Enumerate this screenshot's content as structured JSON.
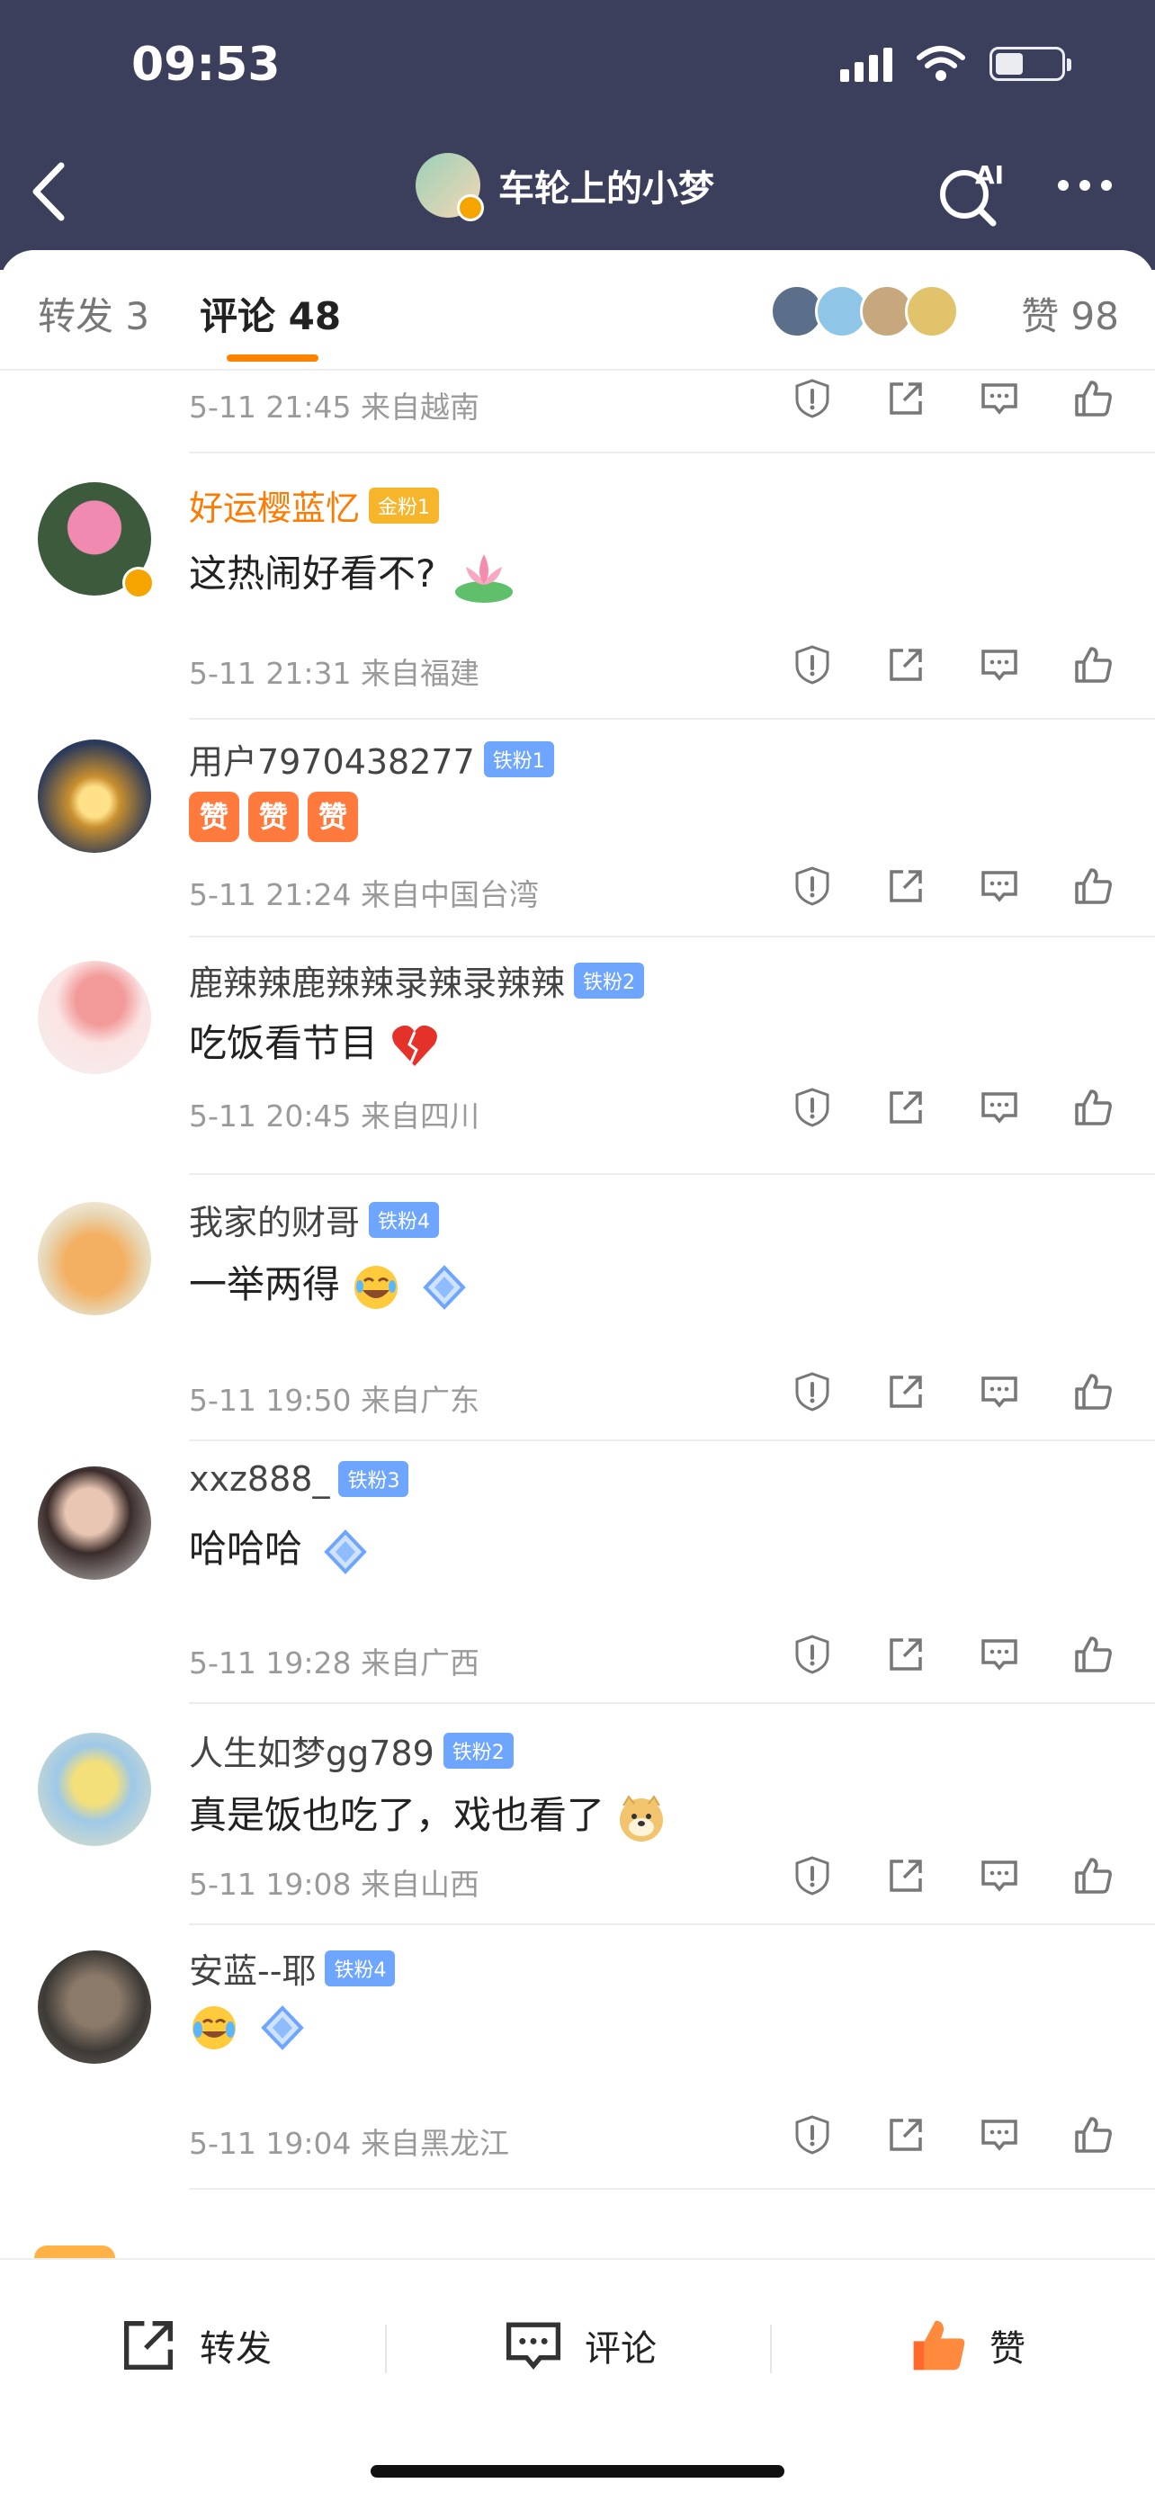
{
  "status_bar": {
    "time": "09:53"
  },
  "nav": {
    "title": "车轮上的小梦",
    "ai_label": "AI"
  },
  "tabs": {
    "repost": "转发 3",
    "comments": "评论 48",
    "likes": "赞 98"
  },
  "comments": [
    {
      "name": "",
      "badge": "",
      "text": "",
      "meta": "5-11 21:45  来自越南"
    },
    {
      "name": "好运樱蓝忆",
      "badge": "金粉1",
      "text": "这热闹好看不?",
      "meta": "5-11 21:31  来自福建"
    },
    {
      "name": "用户7970438277",
      "badge": "铁粉1",
      "text": "",
      "meta": "5-11 21:24  来自中国台湾"
    },
    {
      "name": "鹿辣辣鹿辣辣录辣录辣辣",
      "badge": "铁粉2",
      "text": "吃饭看节目",
      "meta": "5-11 20:45  来自四川"
    },
    {
      "name": "我家的财哥",
      "badge": "铁粉4",
      "text": "一举两得",
      "meta": "5-11 19:50  来自广东"
    },
    {
      "name": "xxz888_",
      "badge": "铁粉3",
      "text": "哈哈哈",
      "meta": "5-11 19:28  来自广西"
    },
    {
      "name": "人生如梦gg789",
      "badge": "铁粉2",
      "text": "真是饭也吃了，戏也看了",
      "meta": "5-11 19:08  来自山西"
    },
    {
      "name": "安蓝--耶",
      "badge": "铁粉4",
      "text": "",
      "meta": "5-11 19:04  来自黑龙江"
    }
  ],
  "stickers": {
    "zan": "赞"
  },
  "bottom_bar": {
    "repost": "转发",
    "comment": "评论",
    "like": "赞"
  },
  "colors": {
    "header": "#3b3f5c",
    "accent": "#ff8200",
    "badge": "#6ea5ff",
    "gold_badge": "#f7b52c"
  },
  "icons": [
    "back-icon",
    "ai-search-icon",
    "more-icon",
    "report-icon",
    "share-icon",
    "reply-icon",
    "like-icon",
    "repost-icon",
    "comment-icon"
  ]
}
